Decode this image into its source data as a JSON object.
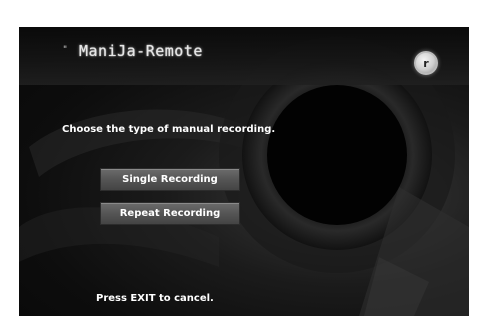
{
  "header": {
    "title": "ManiJa-Remote",
    "dots": "\" ",
    "record_icon_glyph": "r"
  },
  "main": {
    "instruction": "Choose the type of manual recording.",
    "buttons": [
      {
        "label": "Single Recording"
      },
      {
        "label": "Repeat Recording"
      }
    ]
  },
  "footer": {
    "hint": "Press EXIT to cancel."
  },
  "colors": {
    "background": "#0d0d0d",
    "button": "#555555",
    "text": "#ffffff"
  }
}
